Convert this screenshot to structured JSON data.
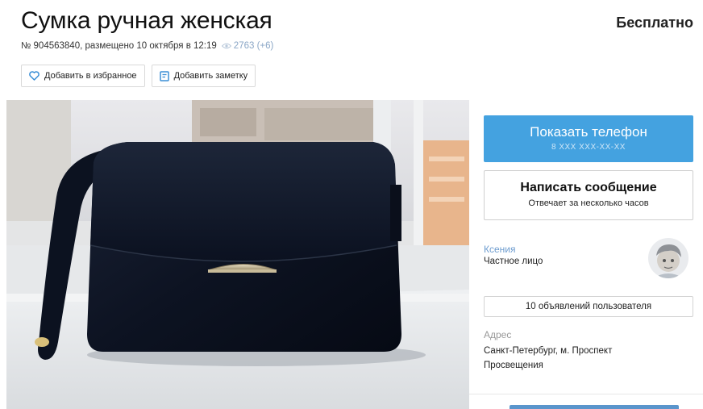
{
  "listing": {
    "title": "Сумка ручная женская",
    "price": "Бесплатно",
    "meta": "№ 904563840, размещено 10 октября в 12:19",
    "views": "2763 (+6)"
  },
  "actions": {
    "favorite_label": "Добавить в избранное",
    "note_label": "Добавить заметку"
  },
  "contact": {
    "phone_label": "Показать телефон",
    "phone_masked": "8 XXX XXX-XX-XX",
    "message_label": "Написать сообщение",
    "message_sub": "Отвечает за несколько часов"
  },
  "seller": {
    "name": "Ксения",
    "type": "Частное лицо",
    "ads_label": "10 объявлений пользователя"
  },
  "address": {
    "label": "Адрес",
    "value": "Санкт-Петербург, м. Проспект Просвещения"
  },
  "colors": {
    "accent": "#44a2e0",
    "link": "#6d9ccf"
  },
  "icons": [
    "heart-icon",
    "note-icon",
    "eye-icon"
  ]
}
